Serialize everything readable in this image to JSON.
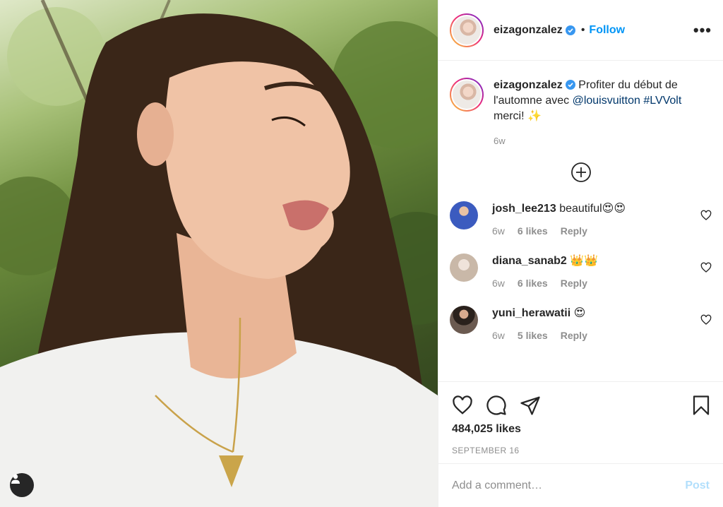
{
  "post": {
    "author": "eizagonzalez",
    "follow_label": "Follow",
    "dot": "•",
    "more_label": "•••"
  },
  "caption": {
    "username": "eizagonzalez",
    "text_before": "Profiter du début de l'automne avec",
    "mention": "@louisvuitton",
    "hashtag": "#LVVolt",
    "text_after": "merci! ✨",
    "time": "6w"
  },
  "comments": [
    {
      "username": "josh_lee213",
      "text": "beautiful😍😍",
      "time": "6w",
      "likes": "6 likes",
      "reply": "Reply",
      "avatar_color": "#3b5bbf"
    },
    {
      "username": "diana_sanab2",
      "text": "👑👑",
      "time": "6w",
      "likes": "6 likes",
      "reply": "Reply",
      "avatar_color": "#c9b8a8"
    },
    {
      "username": "yuni_herawatii",
      "text": "😍",
      "time": "6w",
      "likes": "5 likes",
      "reply": "Reply",
      "avatar_color": "#6b5a50"
    }
  ],
  "likes_count": "484,025 likes",
  "date": "SEPTEMBER 16",
  "add_comment": {
    "placeholder": "Add a comment…",
    "post_label": "Post"
  },
  "colors": {
    "accent": "#0095f6",
    "link": "#00376b",
    "muted": "#8e8e8e",
    "post_disabled": "#b2dffc"
  },
  "icons": [
    "heart-icon",
    "comment-icon",
    "share-icon",
    "bookmark-icon",
    "plus-circle-icon",
    "verified-icon",
    "user-tag-icon",
    "more-icon"
  ]
}
